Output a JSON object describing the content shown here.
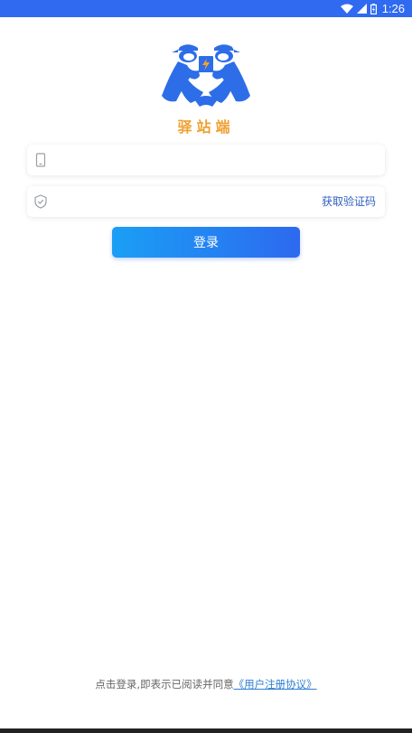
{
  "status_bar": {
    "time": "1:26",
    "color": "#2f6af0"
  },
  "brand": {
    "name": "驿站端",
    "logo_icon": "couriers-carrying-box-logo",
    "color": "#f0a030"
  },
  "form": {
    "phone": {
      "icon": "phone-icon",
      "value": "",
      "placeholder": ""
    },
    "code": {
      "icon": "shield-check-icon",
      "value": "",
      "placeholder": "",
      "get_code_label": "获取验证码"
    },
    "login_label": "登录"
  },
  "agreement": {
    "prefix": "点击登录,即表示已阅读并同意",
    "link": "《用户注册协议》"
  },
  "colors": {
    "primary": "#2d69ef",
    "primary_light": "#1a9ff5",
    "link": "#2f7fd0"
  }
}
